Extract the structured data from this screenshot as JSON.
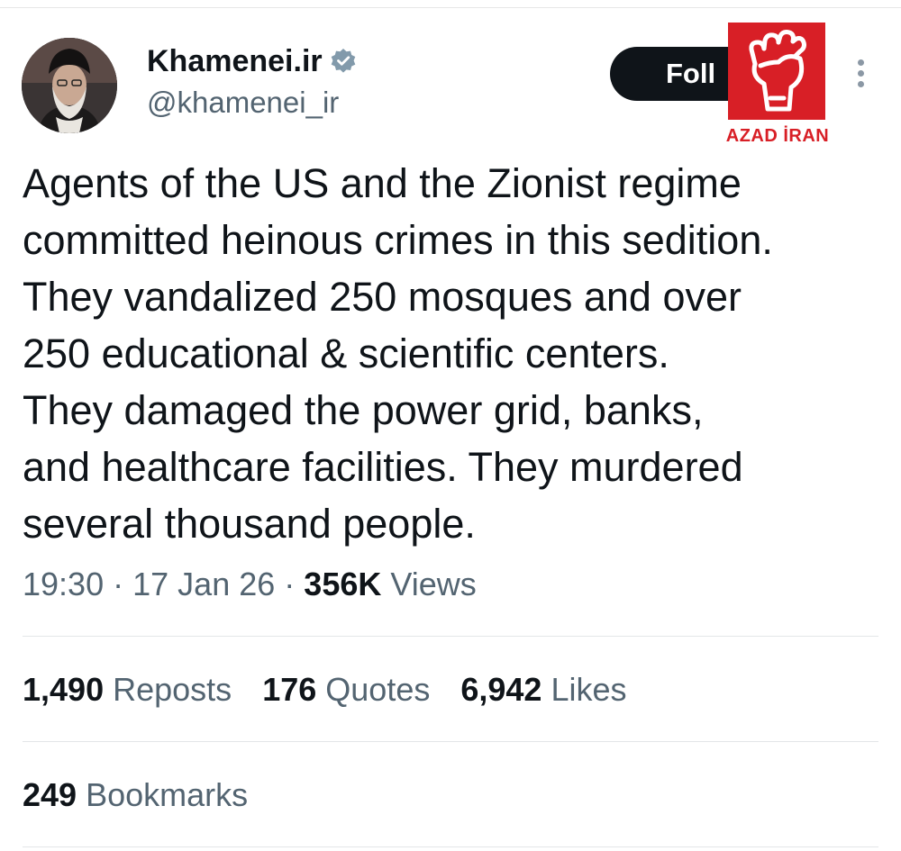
{
  "author": {
    "display_name": "Khamenei.ir",
    "handle": "@khamenei_ir",
    "verified": true
  },
  "follow_button": {
    "label": "Foll"
  },
  "watermark": {
    "text": "AZAD İRAN",
    "color": "#d81f26"
  },
  "tweet": {
    "lines": [
      "Agents of the US and the Zionist regime",
      "committed heinous crimes in this sedition.",
      "They vandalized 250 mosques and over",
      "250 educational & scientific centers.",
      "They damaged the power grid, banks,",
      "and healthcare facilities. They murdered",
      "several thousand people."
    ]
  },
  "meta": {
    "time": "19:30",
    "date": "17 Jan 26",
    "views_count": "356K",
    "views_label": "Views",
    "separator": "·"
  },
  "stats": {
    "reposts_count": "1,490",
    "reposts_label": "Reposts",
    "quotes_count": "176",
    "quotes_label": "Quotes",
    "likes_count": "6,942",
    "likes_label": "Likes",
    "bookmarks_count": "249",
    "bookmarks_label": "Bookmarks"
  },
  "icons": {
    "verified": "verified-badge-icon",
    "more": "more-vertical-icon",
    "watermark": "raised-fist-icon"
  },
  "colors": {
    "text": "#0f1419",
    "secondary": "#536471",
    "follow_bg": "#0f1419",
    "verified": "#829aab"
  }
}
